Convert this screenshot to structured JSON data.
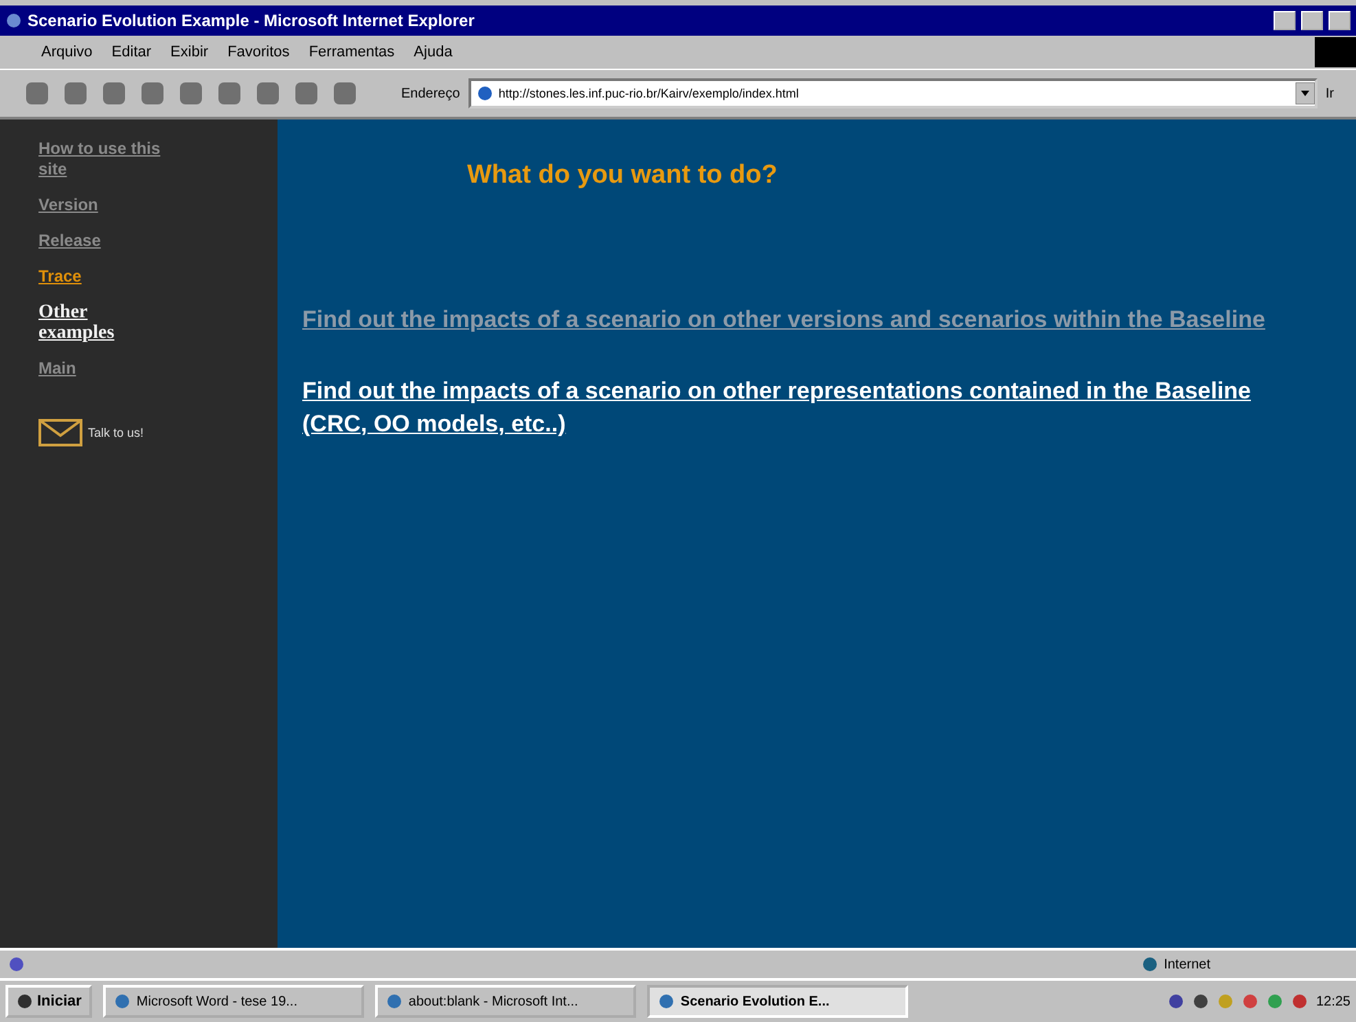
{
  "window": {
    "title": "Scenario Evolution Example - Microsoft Internet Explorer"
  },
  "menu": [
    "Arquivo",
    "Editar",
    "Exibir",
    "Favoritos",
    "Ferramentas",
    "Ajuda"
  ],
  "address": {
    "label": "Endereço",
    "value": "http://stones.les.inf.puc-rio.br/Kairv/exemplo/index.html",
    "go": "Ir"
  },
  "sidebar": {
    "items": [
      {
        "label": "How to use this site",
        "color": "#8a8a8a",
        "bold": false
      },
      {
        "label": "Version",
        "color": "#8a8a8a",
        "bold": false
      },
      {
        "label": "Release",
        "color": "#8a8a8a",
        "bold": false
      },
      {
        "label": "Trace",
        "color": "#e0900a",
        "bold": false
      },
      {
        "label": "Other examples",
        "color": "#f0f0f0",
        "bold": true
      },
      {
        "label": "Main",
        "color": "#8a8a8a",
        "bold": false
      }
    ],
    "contact": "Talk to us!"
  },
  "content": {
    "heading": "What do you want to do?",
    "links": [
      {
        "text": "Find out the impacts of a scenario on other versions and scenarios within the Baseline",
        "visited": true
      },
      {
        "text": "Find out the impacts of a scenario on other representations contained in the Baseline (CRC, OO models, etc..)",
        "visited": false
      }
    ]
  },
  "status_bar": {
    "zone": "Internet"
  },
  "taskbar": {
    "start": "Iniciar",
    "tasks": [
      {
        "label": "Microsoft Word - tese 19...",
        "selected": false
      },
      {
        "label": "about:blank - Microsoft Int...",
        "selected": false
      },
      {
        "label": "Scenario Evolution E...",
        "selected": true
      }
    ],
    "clock": "12:25"
  }
}
